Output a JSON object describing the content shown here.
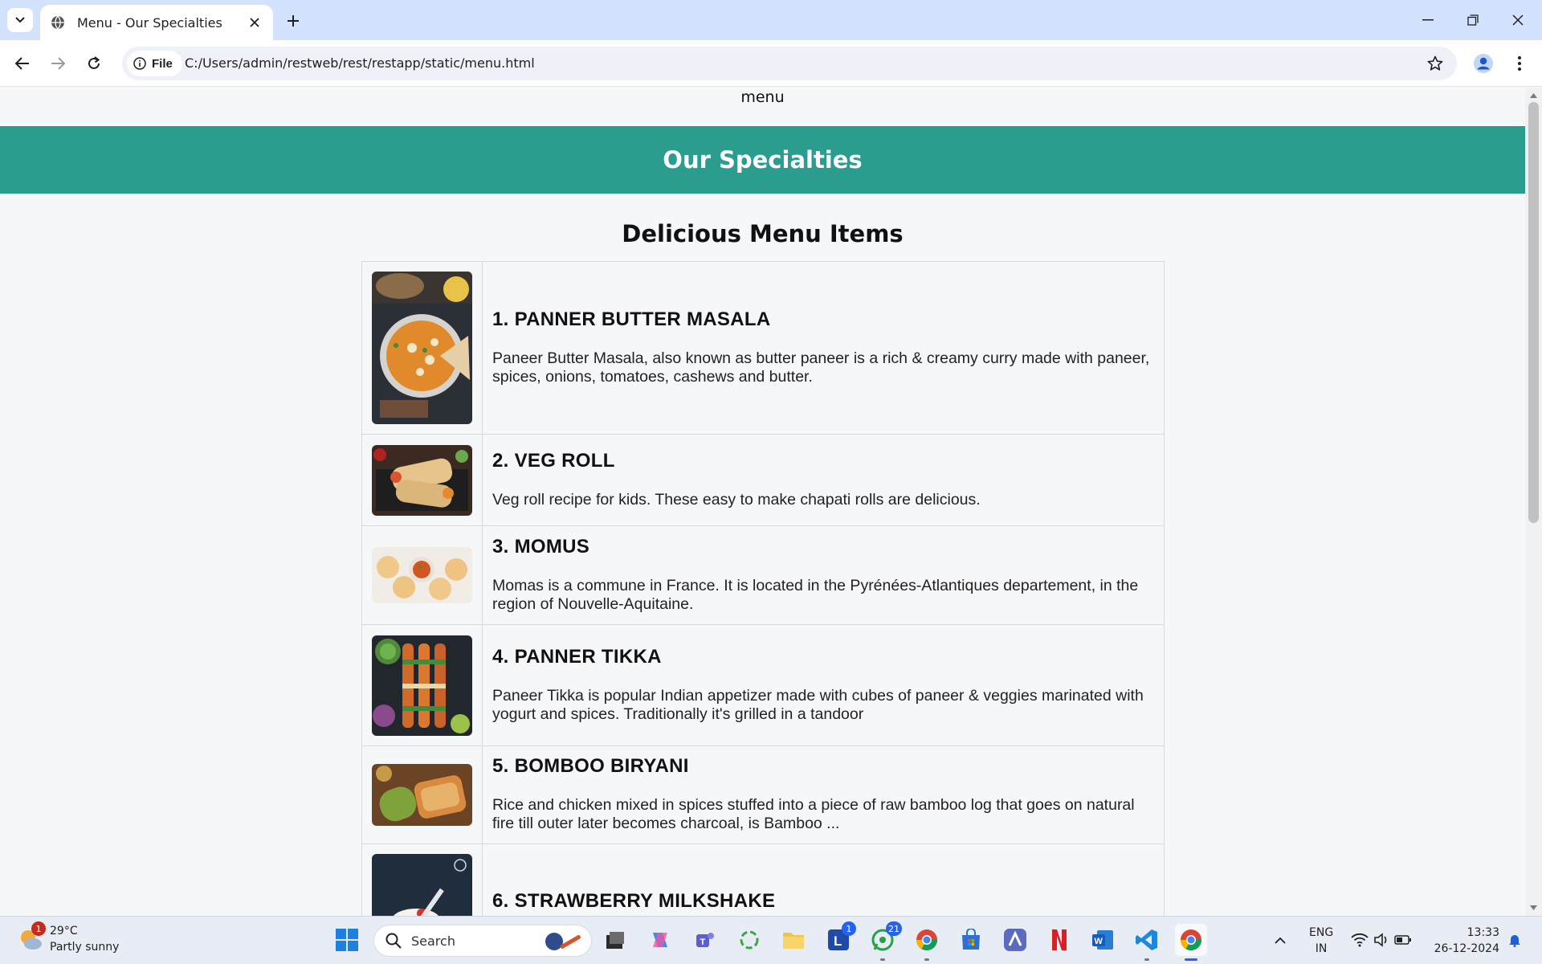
{
  "browser": {
    "tab_title": "Menu - Our Specialties",
    "site_chip_label": "File",
    "url": "C:/Users/admin/restweb/rest/restapp/static/menu.html"
  },
  "page": {
    "top_nav": "menu",
    "hero_title": "Our Specialties",
    "section_title": "Delicious Menu Items",
    "items": [
      {
        "name": "1. PANNER BUTTER MASALA",
        "description": "Paneer Butter Masala, also known as butter paneer is a rich & creamy curry made with paneer, spices, onions, tomatoes, cashews and butter."
      },
      {
        "name": "2. VEG ROLL",
        "description": "Veg roll recipe for kids. These easy to make chapati rolls are delicious."
      },
      {
        "name": "3. MOMUS",
        "description": "Momas is a commune in France. It is located in the Pyrénées-Atlantiques departement, in the region of Nouvelle-Aquitaine."
      },
      {
        "name": "4. PANNER TIKKA",
        "description": "Paneer Tikka is popular Indian appetizer made with cubes of paneer & veggies marinated with yogurt and spices. Traditionally it's grilled in a tandoor"
      },
      {
        "name": "5. BOMBOO BIRYANI",
        "description": "Rice and chicken mixed in spices stuffed into a piece of raw bamboo log that goes on natural fire till outer later becomes charcoal, is Bamboo ..."
      },
      {
        "name": "6. STRAWBERRY MILKSHAKE",
        "description": ""
      }
    ]
  },
  "taskbar": {
    "weather_temp": "29°C",
    "weather_desc": "Partly sunny",
    "weather_badge": "1",
    "search_label": "Search",
    "launcher_badge": "1",
    "whatsapp_badge": "21",
    "lang_top": "ENG",
    "lang_bottom": "IN",
    "time": "13:33",
    "date": "26-12-2024"
  },
  "colors": {
    "hero": "#2a9d8f",
    "tabstrip": "#d3e3fd",
    "page_bg": "#f6f7f8"
  }
}
